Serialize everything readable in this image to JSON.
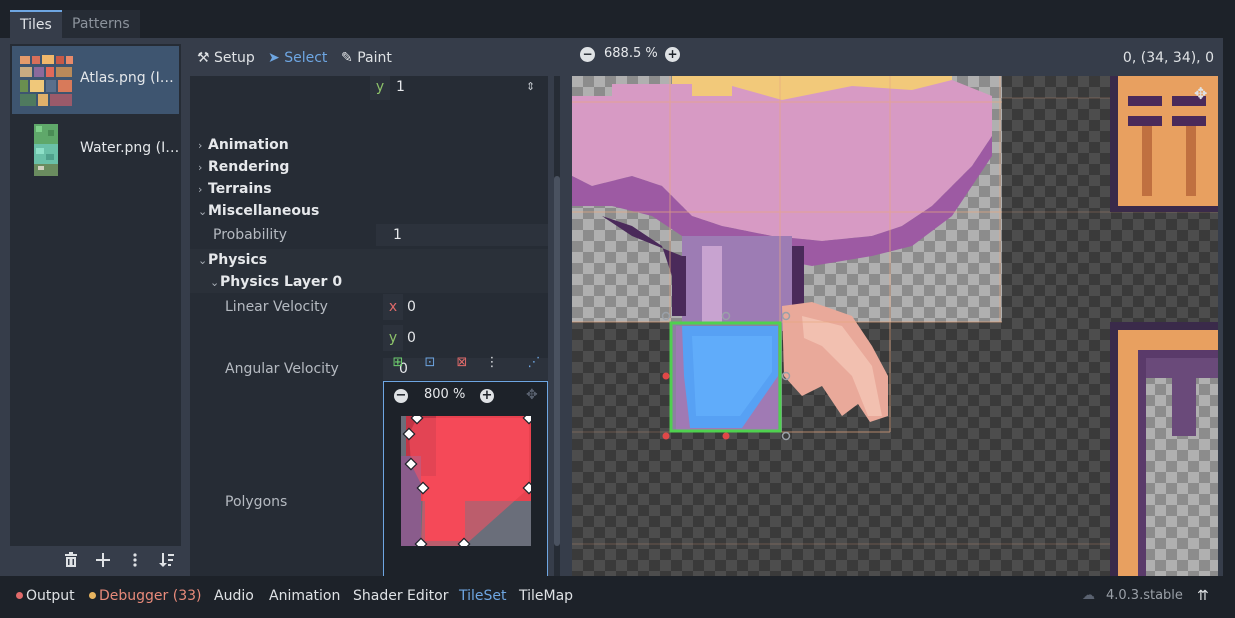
{
  "tabs": {
    "tiles": "Tiles",
    "patterns": "Patterns"
  },
  "sources": [
    {
      "label": "Atlas.png (I…",
      "selected": true
    },
    {
      "label": "Water.png (I…",
      "selected": false
    }
  ],
  "toolbar": {
    "setup": "Setup",
    "select": "Select",
    "paint": "Paint",
    "coords": "0, (34, 34), 0"
  },
  "inspector": {
    "top_vec": {
      "axis": "y",
      "value": "1"
    },
    "sections": {
      "animation": "Animation",
      "rendering": "Rendering",
      "terrains": "Terrains",
      "miscellaneous": "Miscellaneous",
      "physics": "Physics",
      "physics_layer": "Physics Layer 0"
    },
    "probability": {
      "label": "Probability",
      "value": "1"
    },
    "linear_velocity": {
      "label": "Linear Velocity",
      "x_tag": "x",
      "x": "0",
      "y_tag": "y",
      "y": "0"
    },
    "angular_velocity": {
      "label": "Angular Velocity",
      "value": "0"
    },
    "polygons": {
      "label": "Polygons",
      "zoom": "800 %"
    }
  },
  "canvas": {
    "zoom": "688.5 %"
  },
  "bottom": {
    "output": "Output",
    "debugger": "Debugger (33)",
    "audio": "Audio",
    "animation": "Animation",
    "shader_editor": "Shader Editor",
    "tileset": "TileSet",
    "tilemap": "TileMap",
    "version": "4.0.3.stable"
  },
  "colors": {
    "accent": "#6ea6e2",
    "error": "#e06a6a",
    "warning": "#e8b45f",
    "selection_green": "#4fd14f"
  }
}
